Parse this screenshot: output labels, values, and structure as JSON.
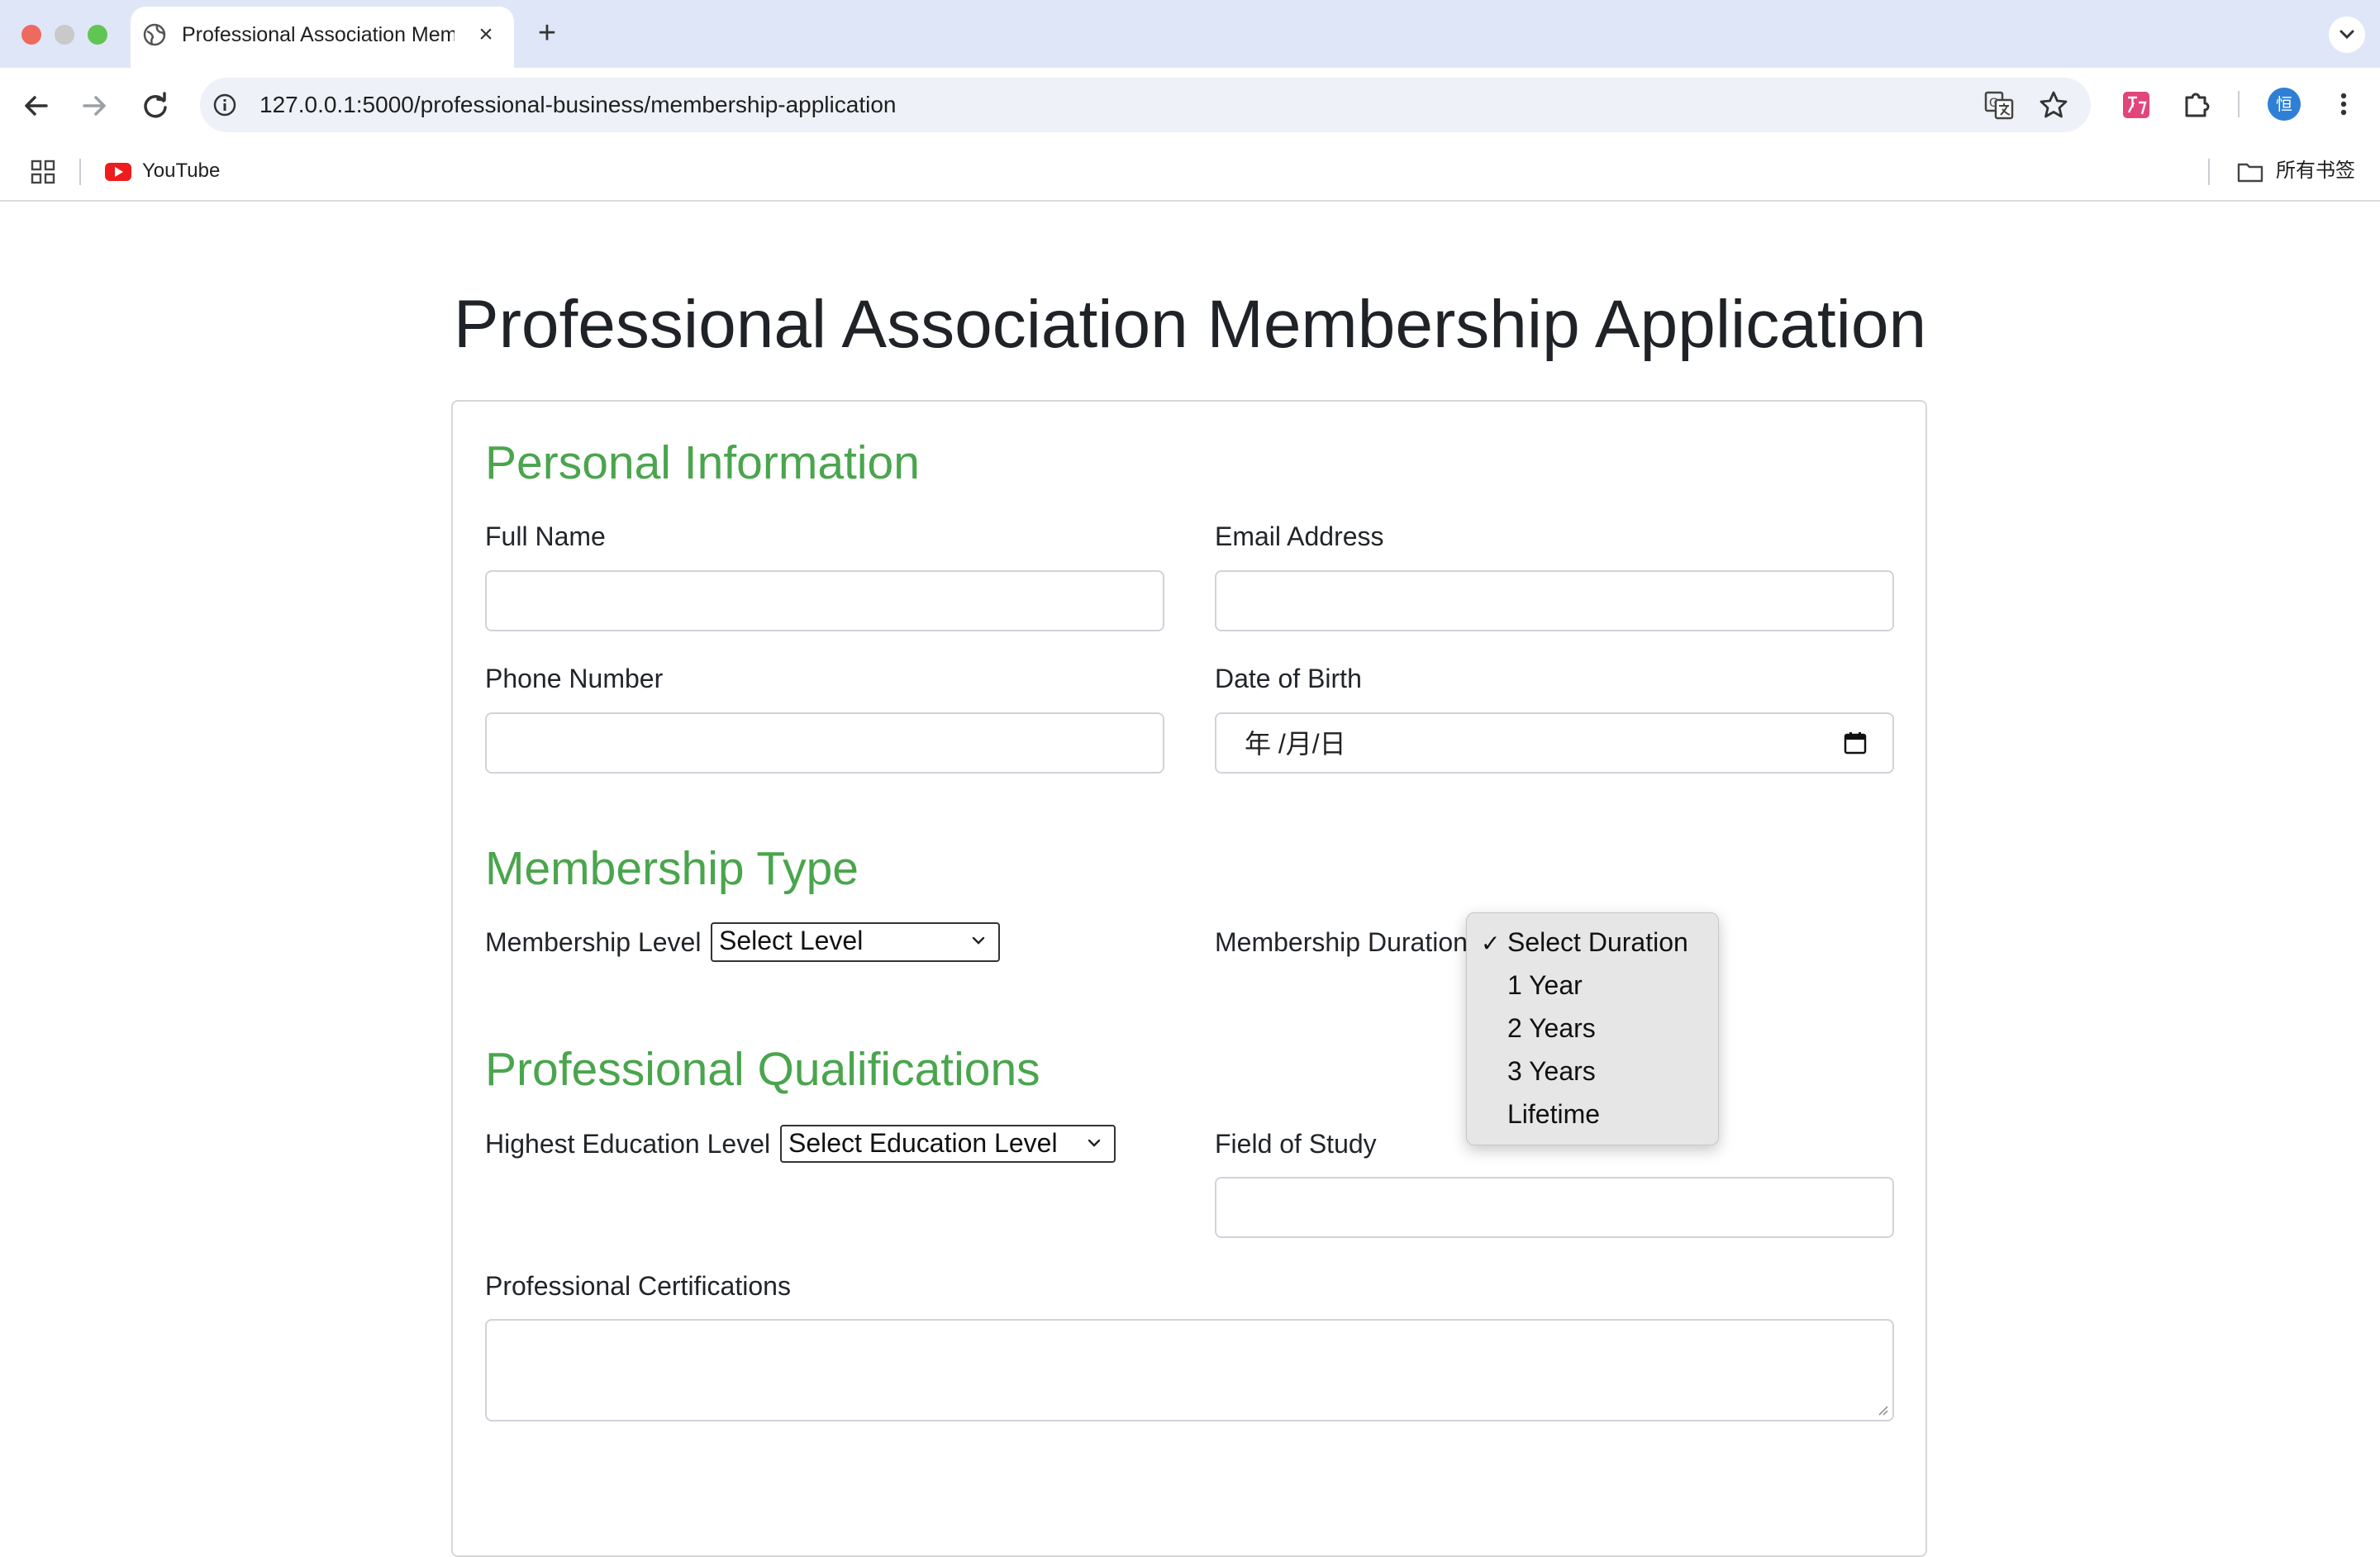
{
  "browser": {
    "tab_title": "Professional Association Membership Application",
    "new_tab_symbol": "+",
    "close_symbol": "×",
    "url": "127.0.0.1:5000/professional-business/membership-application",
    "bookmarks": {
      "youtube": "YouTube",
      "all_bookmarks": "所有书签"
    },
    "profile_initial": "恒"
  },
  "page": {
    "title": "Professional Association Membership Application"
  },
  "personal": {
    "heading": "Personal Information",
    "full_name_label": "Full Name",
    "email_label": "Email Address",
    "phone_label": "Phone Number",
    "dob_label": "Date of Birth",
    "dob_placeholder": "年 /月/日"
  },
  "membership": {
    "heading": "Membership Type",
    "level_label": "Membership Level",
    "level_value": "Select Level",
    "duration_label": "Membership Duration",
    "duration_options": [
      "Select Duration",
      "1 Year",
      "2 Years",
      "3 Years",
      "Lifetime"
    ],
    "duration_selected": "Select Duration",
    "check_mark": "✓"
  },
  "qualifications": {
    "heading": "Professional Qualifications",
    "education_label": "Highest Education Level",
    "education_value": "Select Education Level",
    "field_label": "Field of Study",
    "certifications_label": "Professional Certifications"
  },
  "colors": {
    "section_heading": "#4aa54d",
    "tabbar": "#dfe6f7"
  }
}
